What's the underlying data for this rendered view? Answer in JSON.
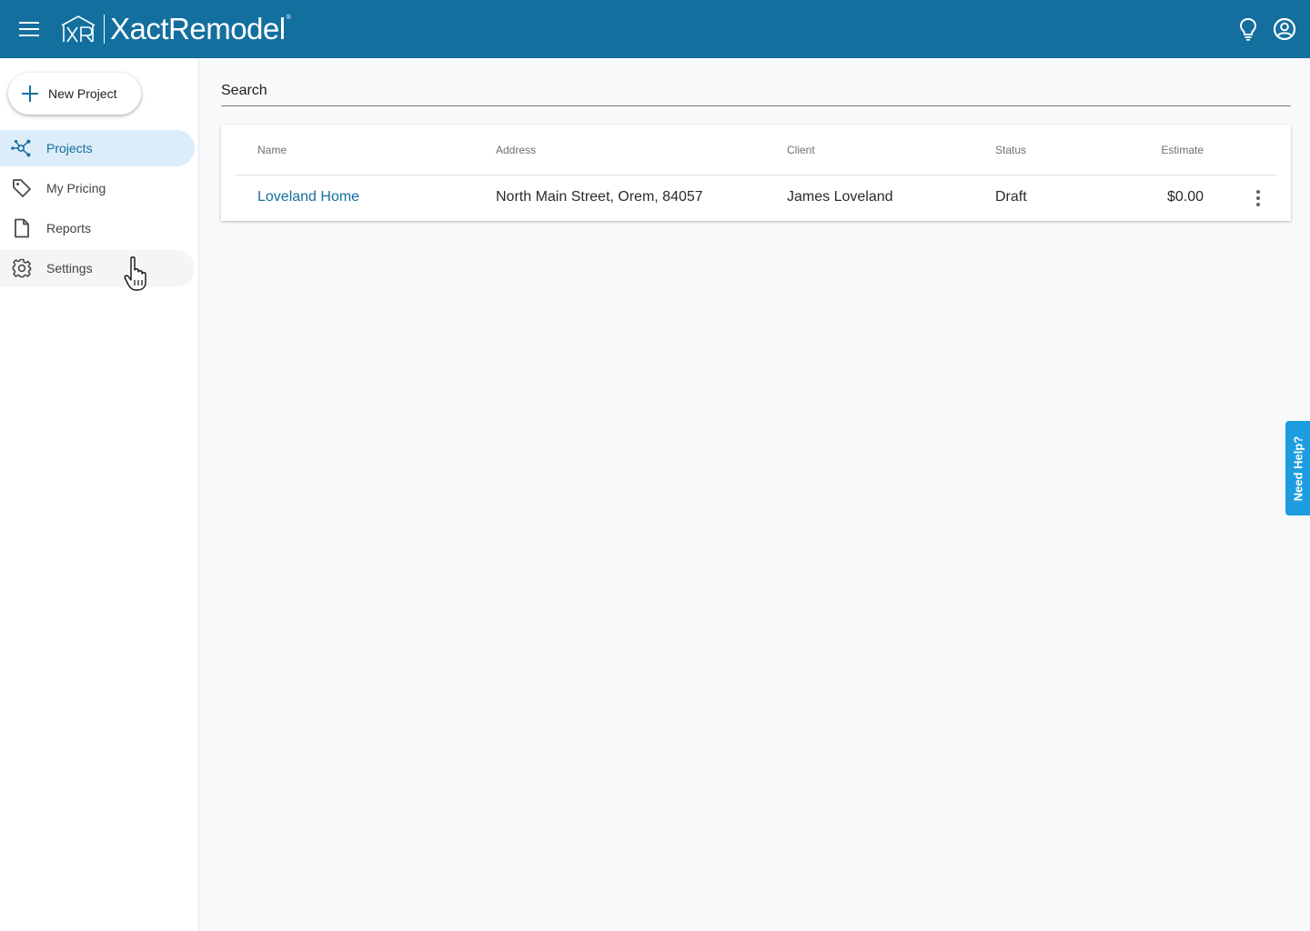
{
  "app": {
    "name": "XactRemodel",
    "brand_color": "#136f9e"
  },
  "header": {
    "menu_icon": "hamburger-icon",
    "logo_text": "XactRemodel",
    "logo_reg": "®",
    "right_icons": [
      "lightbulb-icon",
      "account-circle-icon"
    ]
  },
  "sidebar": {
    "new_project_label": "New Project",
    "items": [
      {
        "label": "Projects",
        "icon": "projects-network-icon",
        "active": true
      },
      {
        "label": "My Pricing",
        "icon": "tag-icon",
        "active": false
      },
      {
        "label": "Reports",
        "icon": "document-icon",
        "active": false
      },
      {
        "label": "Settings",
        "icon": "gear-icon",
        "active": false,
        "hovered": true
      }
    ]
  },
  "search": {
    "placeholder": "Search",
    "value": ""
  },
  "table": {
    "columns": [
      "Name",
      "Address",
      "Client",
      "Status",
      "Estimate"
    ],
    "rows": [
      {
        "name": "Loveland Home",
        "address": "North Main Street, Orem, 84057",
        "client": "James Loveland",
        "status": "Draft",
        "estimate": "$0.00"
      }
    ]
  },
  "help_tab": {
    "label": "Need Help?",
    "color": "#1d9de0"
  }
}
